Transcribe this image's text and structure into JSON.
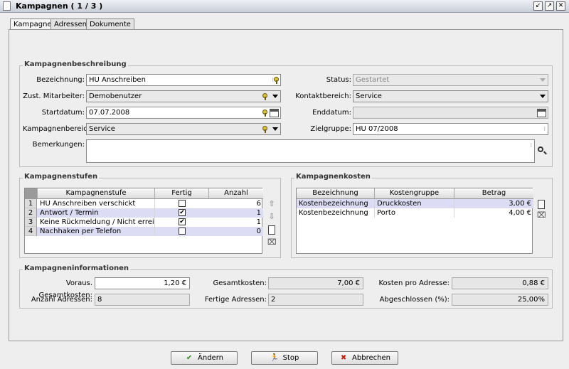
{
  "window": {
    "title": "Kampagnen ( 1 / 3 )"
  },
  "tabs": [
    {
      "label": "Kampagne"
    },
    {
      "label": "Adressen"
    },
    {
      "label": "Dokumente"
    }
  ],
  "beschreibung": {
    "title": "Kampagnenbeschreibung",
    "bezeichnung_label": "Bezeichnung:",
    "bezeichnung_value": "HU Anschreiben",
    "mitarbeiter_label": "Zust. Mitarbeiter:",
    "mitarbeiter_value": "Demobenutzer",
    "startdatum_label": "Startdatum:",
    "startdatum_value": "07.07.2008",
    "bereich_label": "Kampagnenbereich:",
    "bereich_value": "Service",
    "bemerkungen_label": "Bemerkungen:",
    "bemerkungen_value": "",
    "status_label": "Status:",
    "status_value": "Gestartet",
    "kontaktbereich_label": "Kontaktbereich:",
    "kontaktbereich_value": "Service",
    "enddatum_label": "Enddatum:",
    "enddatum_value": "",
    "zielgruppe_label": "Zielgruppe:",
    "zielgruppe_value": "HU 07/2008"
  },
  "stufen": {
    "title": "Kampagnenstufen",
    "columns": [
      "Kampagnenstufe",
      "Fertig",
      "Anzahl"
    ],
    "rows": [
      {
        "num": "1",
        "name": "HU Anschreiben verschickt",
        "fertig": false,
        "anzahl": "6"
      },
      {
        "num": "2",
        "name": "Antwort / Termin",
        "fertig": true,
        "anzahl": "1"
      },
      {
        "num": "3",
        "name": "Keine Rückmeldung / Nicht erreicht",
        "fertig": true,
        "anzahl": "1"
      },
      {
        "num": "4",
        "name": "Nachhaken per Telefon",
        "fertig": false,
        "anzahl": "0"
      }
    ]
  },
  "kosten": {
    "title": "Kampagnenkosten",
    "columns": [
      "Bezeichnung",
      "Kostengruppe",
      "Betrag"
    ],
    "rows": [
      {
        "bez": "Kostenbezeichnung",
        "gruppe": "Druckkosten",
        "betrag": "3,00 €"
      },
      {
        "bez": "Kostenbezeichnung",
        "gruppe": "Porto",
        "betrag": "4,00 €"
      }
    ]
  },
  "info": {
    "title": "Kampagneninformationen",
    "voraus_label": "Voraus. Gesamtkosten:",
    "voraus_value": "1,20 €",
    "gesamt_label": "Gesamtkosten:",
    "gesamt_value": "7,00 €",
    "proadresse_label": "Kosten pro Adresse:",
    "proadresse_value": "0,88 €",
    "anzahl_label": "Anzahl Adressen:",
    "anzahl_value": "8",
    "fertige_label": "Fertige Adressen:",
    "fertige_value": "2",
    "abgeschlossen_label": "Abgeschlossen (%):",
    "abgeschlossen_value": "25,00%"
  },
  "buttons": {
    "aendern": "Ändern",
    "stop": "Stop",
    "abbrechen": "Abbrechen"
  },
  "colors": {
    "selected_row": "#dcdcf5",
    "check_green": "#2a8a1a",
    "cancel_red": "#c0201a"
  }
}
